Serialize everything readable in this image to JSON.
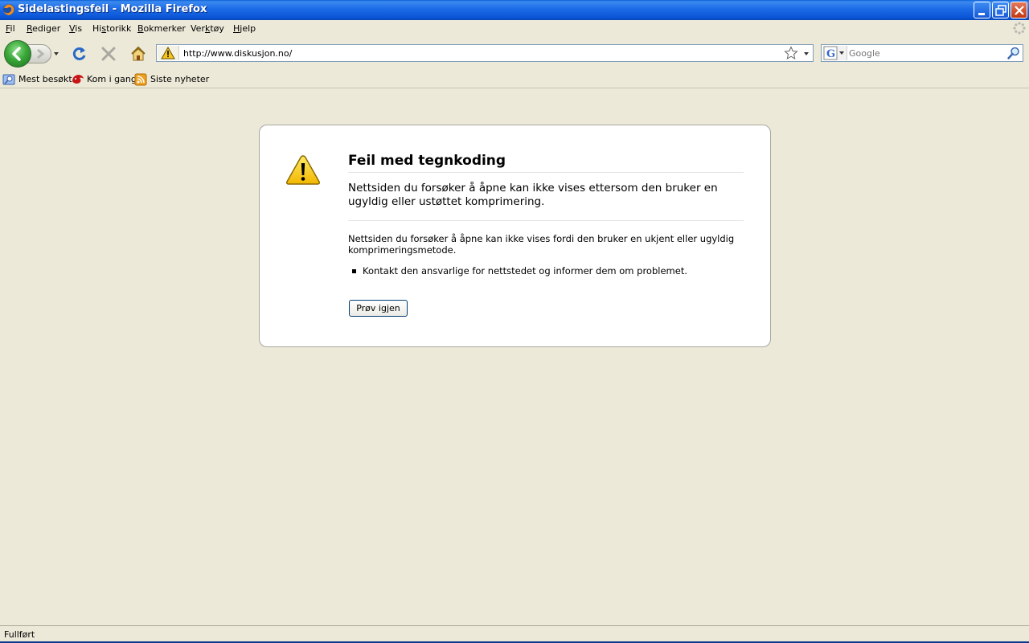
{
  "window": {
    "title": "Sidelastingsfeil - Mozilla Firefox"
  },
  "menu": {
    "items": [
      {
        "label": "Fil",
        "underline": "F",
        "rest": "il"
      },
      {
        "label": "Rediger",
        "underline": "R",
        "rest": "ediger"
      },
      {
        "label": "Vis",
        "underline": "V",
        "rest": "is"
      },
      {
        "label": "Historikk",
        "pre": "Hi",
        "underline": "s",
        "rest": "torikk"
      },
      {
        "label": "Bokmerker",
        "underline": "B",
        "rest": "okmerker"
      },
      {
        "label": "Verktøy",
        "pre": "Ver",
        "underline": "k",
        "rest": "tøy"
      },
      {
        "label": "Hjelp",
        "underline": "H",
        "rest": "jelp"
      }
    ]
  },
  "navigation": {
    "url": "http://www.diskusjon.no/",
    "search_placeholder": "Google"
  },
  "bookmarks": {
    "items": [
      {
        "label": "Mest besøkt"
      },
      {
        "label": "Kom i gang"
      },
      {
        "label": "Siste nyheter"
      }
    ]
  },
  "error_page": {
    "title": "Feil med tegnkoding",
    "short_desc": "Nettsiden du forsøker å åpne kan ikke vises ettersom den bruker en ugyldig eller ustøttet komprimering.",
    "long_desc": "Nettsiden du forsøker å åpne kan ikke vises fordi den bruker en ukjent eller ugyldig komprimeringsmetode.",
    "suggestions": [
      "Kontakt den ansvarlige for nettstedet og informer dem om problemet."
    ],
    "retry_label": "Prøv igjen"
  },
  "status": {
    "text": "Fullført"
  },
  "colors": {
    "titlebar": "#0a55d6",
    "chrome": "#ece9d8",
    "error_box": "#ffffff"
  }
}
